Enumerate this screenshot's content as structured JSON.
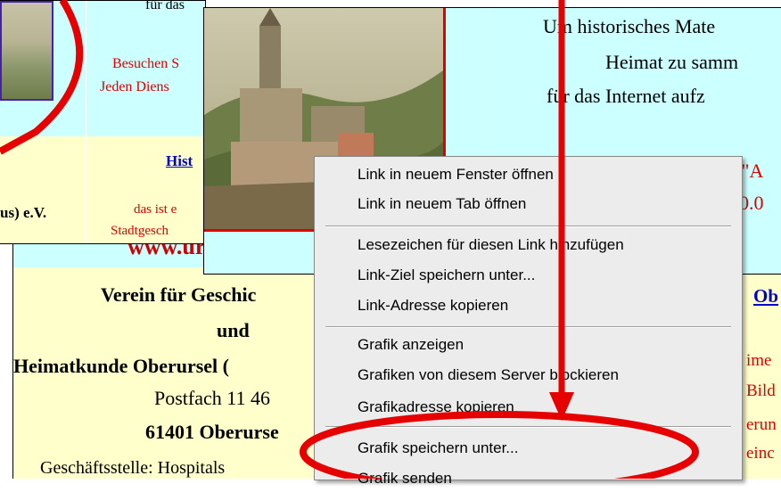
{
  "back_page": {
    "url": "www.ursella.o",
    "left_lines": [
      "Verein für Geschic",
      "und",
      "Heimatkunde Oberursel (",
      "Postfach 11 46",
      "61401 Oberurse",
      "Geschäftsstelle: Hospitals"
    ],
    "right_link": "Ob",
    "right_red_lines": [
      "ime",
      "Bild",
      "erun",
      "einc"
    ]
  },
  "left_window": {
    "top_text": "für das",
    "red_lines": [
      "Besuchen S",
      "Jeden Diens"
    ],
    "link": "Hist",
    "bottom_left": "us) e.V.",
    "bottom_red": [
      "das ist e",
      "Stadtgesch"
    ]
  },
  "main_window": {
    "right_lines": [
      "Um historisches Mate",
      "Heimat zu samm",
      "für das Internet aufz"
    ],
    "right_red": [
      "n \"A",
      "0.0"
    ]
  },
  "context_menu": {
    "items": [
      {
        "label": "Link in neuem Fenster öffnen"
      },
      {
        "label": "Link in neuem Tab öffnen"
      },
      {
        "label": "Lesezeichen für diesen Link hinzufügen"
      },
      {
        "label": "Link-Ziel speichern unter..."
      },
      {
        "label": "Link-Adresse kopieren"
      },
      {
        "label": "Grafik anzeigen"
      },
      {
        "label": "Grafiken von diesem Server blockieren"
      },
      {
        "label": "Grafikadresse kopieren"
      },
      {
        "label": "Grafik speichern unter..."
      },
      {
        "label": "Grafik senden"
      }
    ]
  },
  "colors": {
    "annotation_red": "#e60000",
    "page_cyan": "#ccffff",
    "page_cream": "#ffffcc",
    "menu_bg": "#ececec"
  }
}
